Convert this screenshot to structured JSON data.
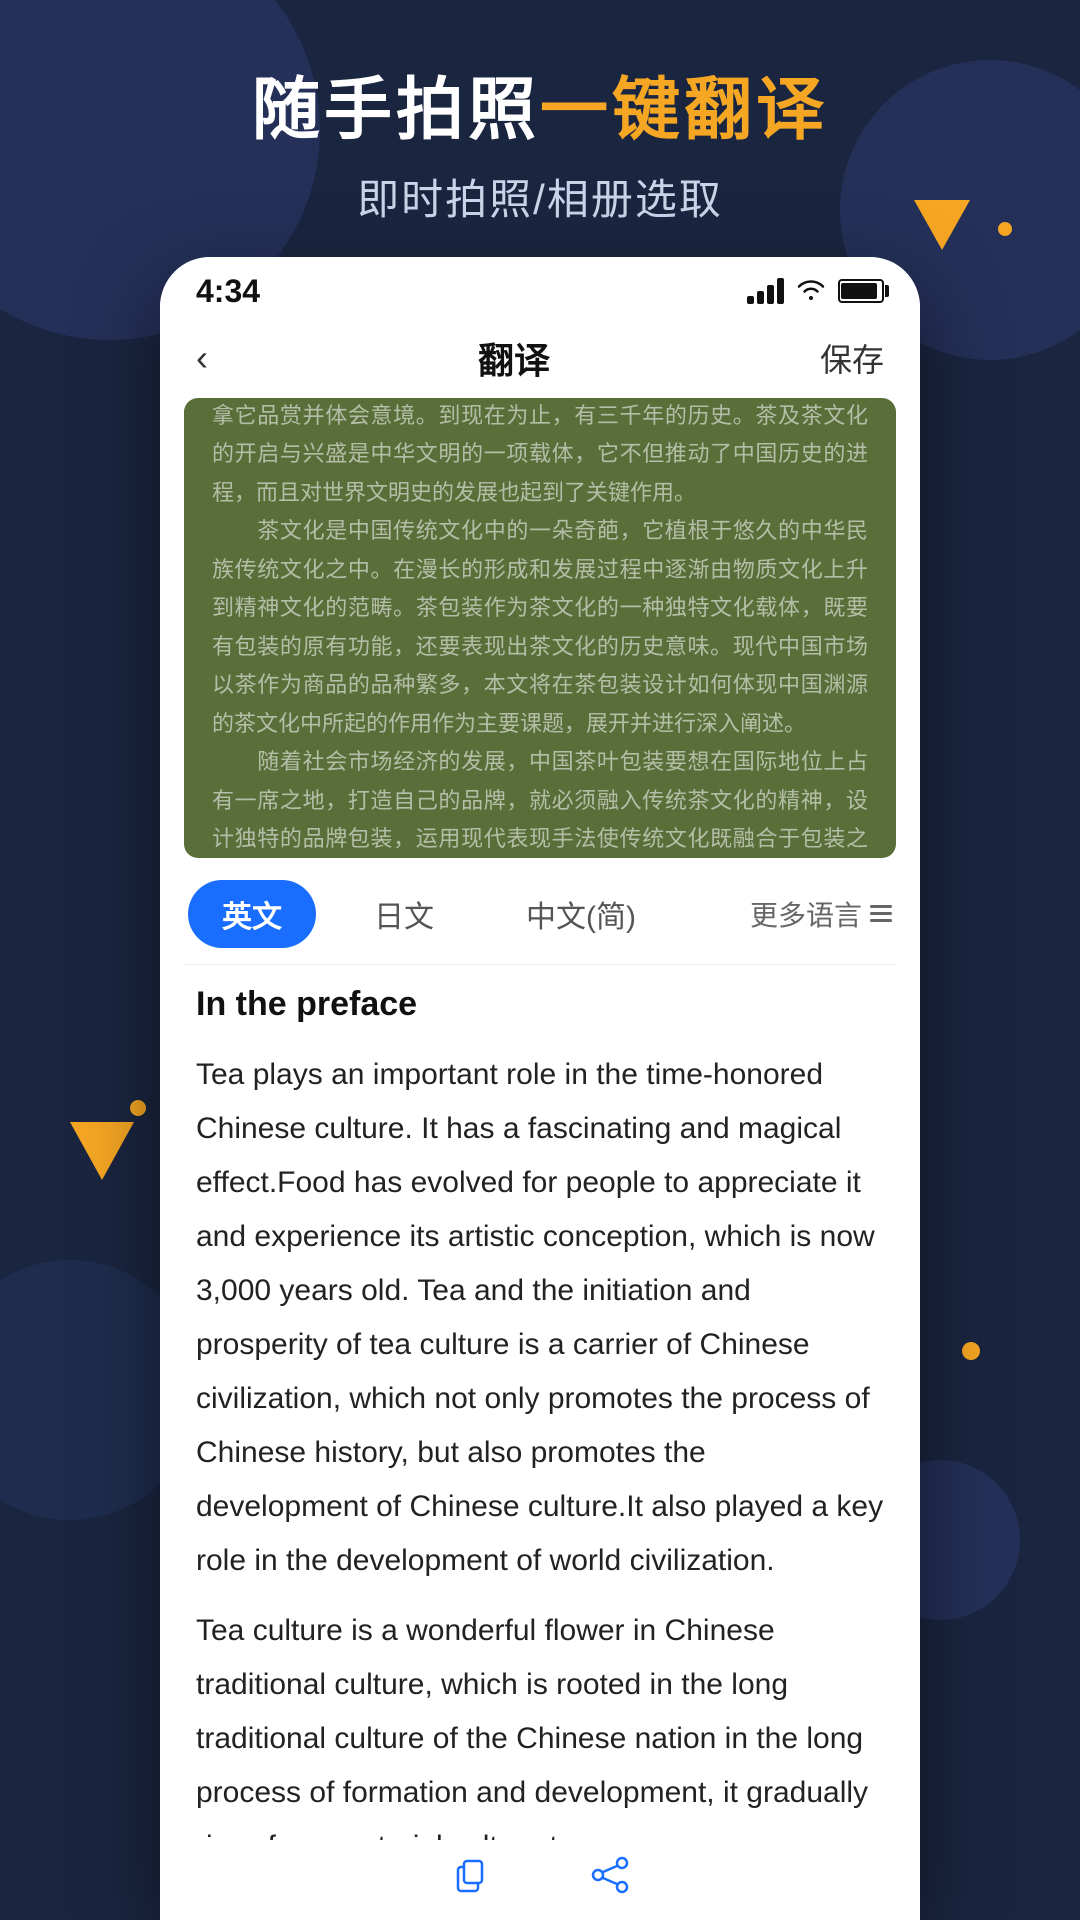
{
  "app": {
    "header": {
      "title_part1": "随手拍照",
      "title_part2": "一键翻译",
      "subtitle": "即时拍照/相册选取"
    },
    "status_bar": {
      "time": "4:34"
    },
    "nav": {
      "title": "翻译",
      "save_label": "保存",
      "back_icon": "‹"
    },
    "image": {
      "chinese_text": "茶，在源远流长的华夏文化中起着重要作用，它有着颇具魅力的神奇功效，为世人所喜爱；它使人们感到清爽、令神经活跃、得到喜爱。茶作为一种饮品，发起于神农氏时期，重现于周公旦，发扬于元唐时期，推广于明清，它的地位由一种生活实用食物进化为人们拿它品赏并体会意境。到现在为止，有三千年的历史。茶及茶文化的开启与兴盛是中华文明的一项载体，它不但推动了中国历史的进程，而且对世界文明史的发展也起到了关键作用。\n　　茶文化是中国传统文化中的一朵奇葩，它植根于悠久的中华民族传统文化之中。在漫长的形成和发展过程中逐渐由物质文化上升到精神文化的范畴。茶包装作为茶文化的一种独特文化载体，既要有包装的原有功能，还要表现出茶文化的历史意味。现代中国市场以茶作为商品的品种繁多，本文将在茶包装设计如何体现中国渊源的茶文化中所起的作用作为主要课题，展开并进行深入阐述。\n　　随着社会市场经济的发展，中国茶叶包装要想在国际地位上占有一席之地，打造自己的品牌，就必须融入传统茶文化的精神，设计独特的品牌包装，运用现代表现手法使传统文化既融合于包装之中，又符合现代审美的结论。茶文化是中国传统文化的重要组成部分，这里既有精神文明的体现，又有意识形态的延伸。无疑，它有益提高人们的文化修养和艺术欣赏水平，茶文化的传承与发展成为当下重要话题"
    },
    "lang_tabs": [
      {
        "label": "英文",
        "active": true
      },
      {
        "label": "日文",
        "active": false
      },
      {
        "label": "中文(简)",
        "active": false
      }
    ],
    "more_lang_label": "更多语言",
    "translation": {
      "title": "In the preface",
      "paragraphs": [
        "Tea plays an important role in the time-honored Chinese culture. It has a fascinating and magical effect.Food has evolved for people to appreciate it and experience its artistic conception, which is now 3,000 years old. Tea and the initiation and prosperity of tea culture is a carrier of Chinese civilization, which not only promotes the process of Chinese history, but also promotes the development of Chinese culture.It also played a key role in the development of world civilization.",
        "Tea culture is a wonderful flower in Chinese traditional culture, which is rooted in the long traditional culture of the Chinese nation in the long process of formation and development, it gradually rises from material culture to"
      ]
    }
  }
}
